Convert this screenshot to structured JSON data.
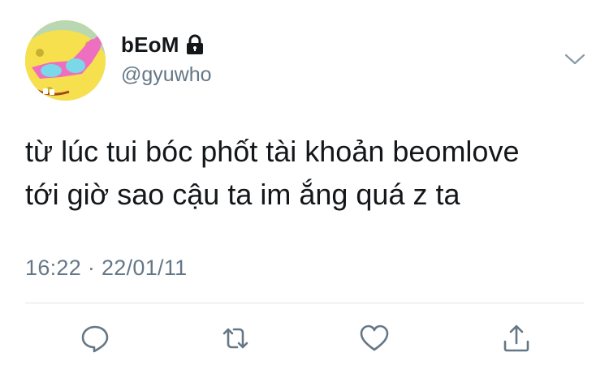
{
  "tweet": {
    "display_name": "bEoM",
    "handle": "@gyuwho",
    "text_lines": [
      "từ lúc tui bóc phốt tài khoản beomlove",
      "tới giờ sao cậu ta im ắng quá z ta"
    ],
    "timestamp": "16:22 · 22/01/11",
    "protected_icon": "lock-icon",
    "avatar": "spongebob-avatar"
  },
  "actions": [
    {
      "name": "reply",
      "icon": "reply-icon"
    },
    {
      "name": "retweet",
      "icon": "retweet-icon"
    },
    {
      "name": "like",
      "icon": "heart-icon"
    },
    {
      "name": "share",
      "icon": "share-icon"
    }
  ],
  "colors": {
    "text": "#14171a",
    "secondary": "#657786",
    "icon": "#657786",
    "divider": "#dfe3e6"
  }
}
